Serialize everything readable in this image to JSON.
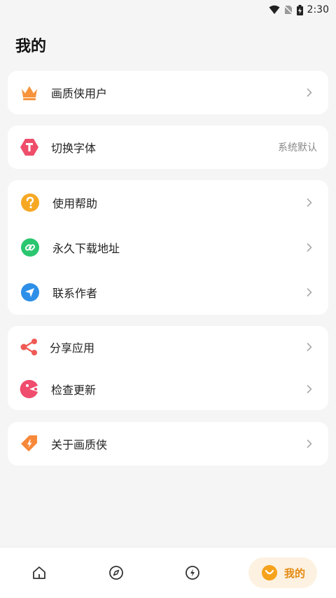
{
  "status_bar": {
    "time": "2:30"
  },
  "page": {
    "title": "我的"
  },
  "sections": {
    "user": {
      "label": "画质侠用户",
      "icon": "crown-icon"
    },
    "font": {
      "label": "切换字体",
      "value": "系统默认",
      "icon": "font-icon"
    },
    "help": {
      "items": [
        {
          "label": "使用帮助",
          "icon": "question-icon"
        },
        {
          "label": "永久下载地址",
          "icon": "link-icon"
        },
        {
          "label": "联系作者",
          "icon": "send-icon"
        }
      ]
    },
    "share": {
      "items": [
        {
          "label": "分享应用",
          "icon": "share-icon"
        },
        {
          "label": "检查更新",
          "icon": "update-icon"
        }
      ]
    },
    "about": {
      "label": "关于画质侠",
      "icon": "tag-icon"
    }
  },
  "tabbar": {
    "items": [
      {
        "icon": "home-icon"
      },
      {
        "icon": "compass-icon"
      },
      {
        "icon": "lightning-icon"
      },
      {
        "icon": "smile-icon",
        "label": "我的",
        "active": true
      }
    ]
  },
  "colors": {
    "accent": "#f6a21a",
    "accent_text": "#e48a11",
    "background": "#f5f5f5"
  }
}
